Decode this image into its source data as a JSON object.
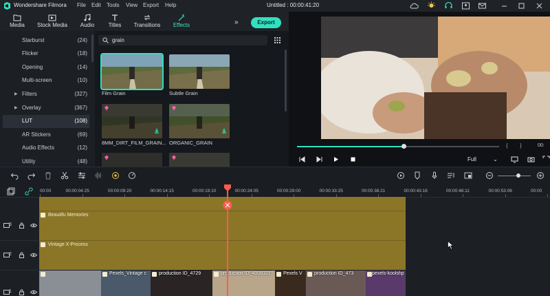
{
  "app": {
    "name": "Wondershare Filmora",
    "document_title": "Untitled : 00:00:41:20"
  },
  "menu": [
    "File",
    "Edit",
    "Tools",
    "View",
    "Export",
    "Help"
  ],
  "toolbar": {
    "tabs": [
      {
        "label": "Media",
        "icon": "folder-icon"
      },
      {
        "label": "Stock Media",
        "icon": "stock-media-icon"
      },
      {
        "label": "Audio",
        "icon": "music-note-icon"
      },
      {
        "label": "Titles",
        "icon": "text-icon"
      },
      {
        "label": "Transitions",
        "icon": "transitions-icon"
      },
      {
        "label": "Effects",
        "icon": "effects-icon",
        "active": true
      }
    ],
    "export_label": "Export",
    "more_label": "»"
  },
  "categories": [
    {
      "name": "Starburst",
      "count": "(24)"
    },
    {
      "name": "Flicker",
      "count": "(18)"
    },
    {
      "name": "Opening",
      "count": "(14)"
    },
    {
      "name": "Multi-screen",
      "count": "(10)"
    },
    {
      "name": "Filters",
      "count": "(327)",
      "expandable": true
    },
    {
      "name": "Overlay",
      "count": "(367)",
      "expandable": true
    },
    {
      "name": "LUT",
      "count": "(108)",
      "active": true
    },
    {
      "name": "AR Stickers",
      "count": "(69)"
    },
    {
      "name": "Audio Effects",
      "count": "(12)"
    },
    {
      "name": "Utility",
      "count": "(48)"
    }
  ],
  "search": {
    "value": "grain"
  },
  "effects": [
    {
      "label": "Film Grain",
      "selected": true
    },
    {
      "label": "Subtle Grain"
    },
    {
      "label": "8MM_DIRT_FILM_GRAIN...",
      "premium": true,
      "download": true
    },
    {
      "label": "ORGANIC_GRAIN",
      "premium": true,
      "download": true
    }
  ],
  "preview": {
    "progress": 0.53,
    "quality": "Full",
    "bracket_left": "{",
    "bracket_right": "}",
    "time_fragment": "00:"
  },
  "ruler": {
    "ticks": [
      "00:00",
      "00:00:04:25",
      "00:00:09:20",
      "00:00:14:15",
      "00:00:19:10",
      "00:00:24:05",
      "00:00:29:00",
      "00:00:33:25",
      "00:00:38:21",
      "00:00:43:16",
      "00:00:48:11",
      "00:00:53:06",
      "00:00"
    ]
  },
  "tracks": {
    "track3_number": "3",
    "track2_number": "2",
    "track1_number": "1",
    "effect_clip_1": "Beautifu Memories",
    "effect_clip_2": "Vintage X-Process",
    "video_clips": [
      "",
      "Pexels_Vintage c",
      "production ID_4729",
      "production ID_4008327",
      "Pexels V",
      "production ID_473",
      "pexels-koolshp"
    ]
  },
  "colors": {
    "accent": "#2fe1bf",
    "clip": "#8b7628",
    "playhead": "#ff5b4f"
  }
}
